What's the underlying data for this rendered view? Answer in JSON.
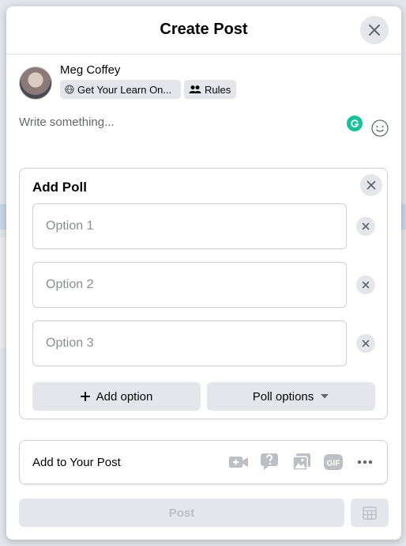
{
  "dialog": {
    "title": "Create Post"
  },
  "author": {
    "name": "Meg Coffey",
    "audience_chip": "Get Your Learn On...",
    "rules_chip": "Rules"
  },
  "composer": {
    "placeholder": "Write something..."
  },
  "poll": {
    "title": "Add Poll",
    "options": [
      {
        "placeholder": "Option 1"
      },
      {
        "placeholder": "Option 2"
      },
      {
        "placeholder": "Option 3"
      }
    ],
    "add_option_label": "Add option",
    "poll_options_label": "Poll options"
  },
  "add_to_post": {
    "label": "Add to Your Post",
    "icons": [
      "video-camera-icon",
      "question-icon",
      "photo-icon",
      "gif-icon",
      "more-icon"
    ]
  },
  "footer": {
    "post_label": "Post"
  },
  "colors": {
    "accent_green": "#15c39a",
    "button_bg": "#e4e6eb",
    "icon_gray": "#bcc0c4"
  }
}
